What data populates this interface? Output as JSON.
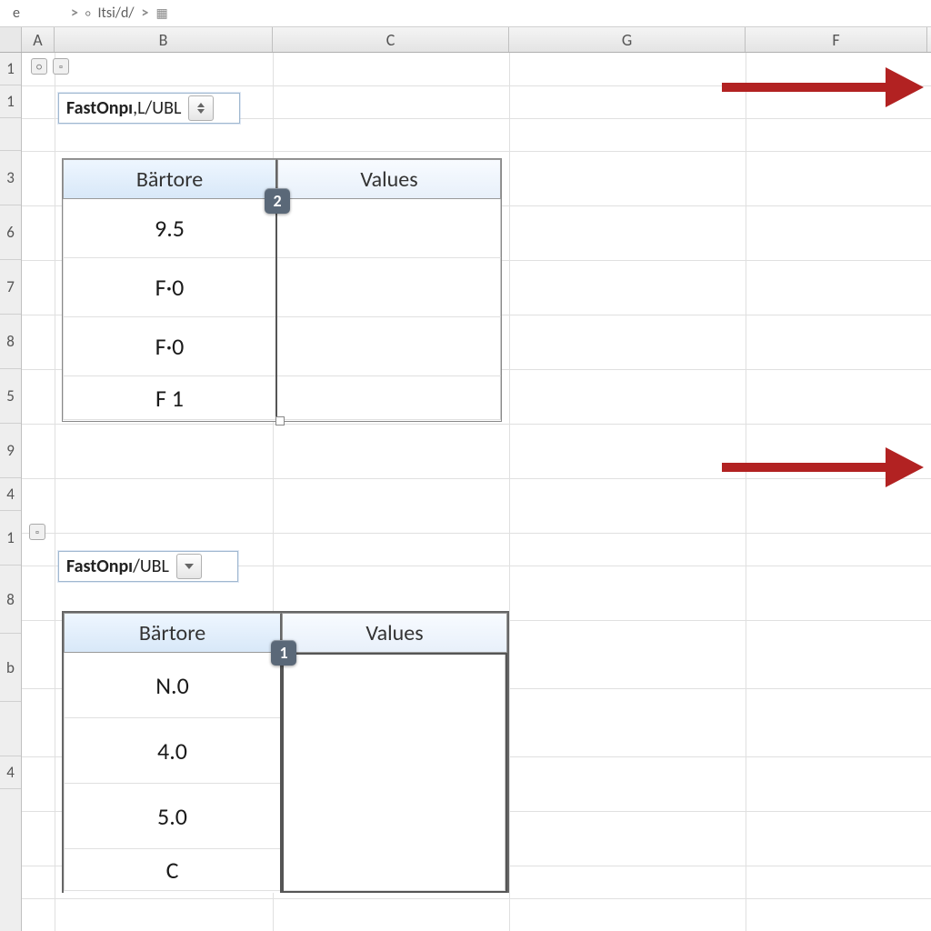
{
  "breadcrumb": {
    "sep1": ">",
    "item1": "Itsi/d/",
    "sep2": ">"
  },
  "columns": [
    "A",
    "B",
    "C",
    "G",
    "F"
  ],
  "row_labels_top": [
    "1",
    "1",
    "",
    "3",
    "6",
    "7",
    "8",
    "5",
    "9"
  ],
  "row_labels_bottom": [
    "4",
    "1",
    "8",
    "b",
    "",
    "4"
  ],
  "dropdown1": {
    "label_bold": "FastOnpı",
    "label_rest": ",L/UBL"
  },
  "dropdown2": {
    "label_bold": "FastOnpı",
    "label_rest": "/UBL"
  },
  "table1": {
    "headers": [
      "Bärtore",
      "Values"
    ],
    "col1": [
      "9.5",
      "F·0",
      "F·0",
      "F 1"
    ],
    "badge": "2"
  },
  "table2": {
    "headers": [
      "Bärtore",
      "Values"
    ],
    "col1": [
      "N.0",
      "4.0",
      "5.0",
      "C"
    ],
    "badge": "1"
  }
}
